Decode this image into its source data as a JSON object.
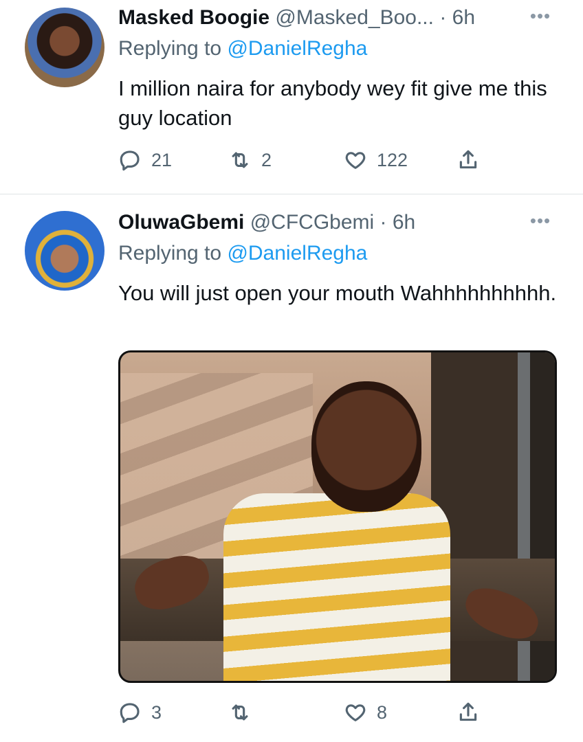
{
  "tweets": [
    {
      "name": "Masked Boogie",
      "handle": "@Masked_Boo...",
      "time": "· 6h",
      "replying_prefix": "Replying to ",
      "replying_to": "@DanielRegha",
      "text": "I million naira for anybody wey fit give me this guy location",
      "replies": "21",
      "retweets": "2",
      "likes": "122"
    },
    {
      "name": "OluwaGbemi",
      "handle": "@CFCGbemi",
      "time": "· 6h",
      "replying_prefix": "Replying to ",
      "replying_to": "@DanielRegha",
      "text": "You will just open your mouth Wahhhhhhhhhh.",
      "replies": "3",
      "retweets": "",
      "likes": "8"
    }
  ],
  "more_glyph": "•••",
  "icons": {
    "reply": "reply-icon",
    "retweet": "retweet-icon",
    "like": "heart-icon",
    "share": "share-icon",
    "more": "more-icon"
  },
  "colors": {
    "link": "#1d9bf0",
    "secondary_text": "#536471",
    "divider": "#dfe3e6"
  }
}
